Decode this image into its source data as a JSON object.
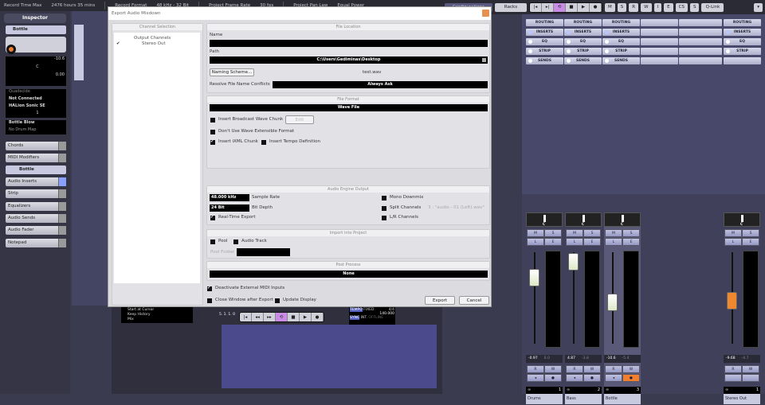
{
  "statusbar": {
    "items": [
      "Record Time Max",
      "2476 hours 35 mins",
      "Record Format",
      "48 kHz - 32 Bit",
      "Project Frame Rate",
      "30 fps",
      "Project Pan Law",
      "Equal Power"
    ]
  },
  "toolbar": {
    "racks": "Racks",
    "configurations": "Configurations",
    "qlink": "Q-Link",
    "automation": [
      "M",
      "S",
      "R",
      "W"
    ],
    "ecs": [
      "I",
      "E",
      "CS",
      "S"
    ]
  },
  "inspector": {
    "title": "Inspector",
    "track_name": "Bottle",
    "volume": "-10.6",
    "pan": "C",
    "delay": "0.00",
    "input": "Quadecide",
    "output": "Not Connected",
    "instrument": "HALion Sonic SE",
    "channel": "1",
    "program": "Bottle Blow",
    "drum_map": "No Drum Map",
    "sections": [
      "Chords",
      "MIDI Modifiers",
      "Bottle",
      "Audio Inserts",
      "Strip",
      "Equalizers",
      "Audio Sends",
      "Audio Fader",
      "Notepad"
    ]
  },
  "dialog": {
    "title": "Export Audio Mixdown",
    "channel_selection": {
      "header": "Channel Selection",
      "root": "Output Channels",
      "item": "Stereo Out"
    },
    "file_location": {
      "header": "File Location",
      "name_label": "Name",
      "name_value": "",
      "path_label": "Path",
      "path_value": "C:\\Users\\Gediminas\\Desktop",
      "naming_scheme": "Naming Scheme...",
      "filename": "test.wav",
      "conflicts_label": "Resolve File Name Conflicts",
      "conflicts_value": "Always Ask"
    },
    "file_format": {
      "header": "File Format",
      "format": "Wave File",
      "bwc": "Insert Broadcast Wave Chunk",
      "edit": "Edit",
      "no_ext": "Don't Use Wave Extensible Format",
      "ixml": "Insert iXML Chunk",
      "tempo": "Insert Tempo Definition"
    },
    "engine": {
      "header": "Audio Engine Output",
      "sample_rate": "48.000 kHz",
      "sample_rate_label": "Sample Rate",
      "bit_depth": "24 Bit",
      "bit_depth_label": "Bit Depth",
      "realtime": "Real-Time Export",
      "mono": "Mono Downmix",
      "split": "Split Channels",
      "split_example": "3 : \"audio - 01 (Left).wav\"",
      "lr": "L/R Channels"
    },
    "import": {
      "header": "Import into Project",
      "pool": "Pool",
      "audio_track": "Audio Track",
      "pool_folder": "Pool Folder"
    },
    "post": {
      "header": "Post Process",
      "value": "None"
    },
    "deactivate_midi": "Deactivate External MIDI Inputs",
    "close_after": "Close Window after Export",
    "update_display": "Update Display",
    "export": "Export",
    "cancel": "Cancel"
  },
  "mixer": {
    "rack_rows": [
      "ROUTING",
      "INSERTS",
      "EQ",
      "STRIP",
      "SENDS"
    ],
    "channels": [
      {
        "name": "Drums",
        "number": "1",
        "volume": "-0.97",
        "peak": "0.0",
        "pan": "C",
        "fader": 0.72,
        "record_on": false
      },
      {
        "name": "Bass",
        "number": "2",
        "volume": "4.87",
        "peak": "-3.8",
        "pan": "C",
        "fader": 0.9,
        "record_on": false
      },
      {
        "name": "Bottle",
        "number": "3",
        "volume": "-10.6",
        "peak": "-5.4",
        "pan": "C",
        "fader": 0.45,
        "record_on": true
      }
    ],
    "master": {
      "name": "Stereo Out",
      "number": "1",
      "volume": "-9.68",
      "peak": "-4.7",
      "pan": "C",
      "fader": 0.47
    },
    "buttons": {
      "m": "M",
      "s": "S",
      "l": "L",
      "e": "E",
      "r": "R",
      "w": "W"
    },
    "accent_record": "#f08030",
    "accent_master_fader": "#f08830"
  },
  "transport": {
    "tempo_label": "TEMPO",
    "tempo_mode": "FIXED",
    "signature": "4/4",
    "tempo": "140.000",
    "sync": "SYNC",
    "int": "INT.",
    "offline": "OFFLINE",
    "history": [
      "Start at Cursor",
      "Keep History",
      "Mix"
    ],
    "position": "5. 1. 1. 0"
  }
}
